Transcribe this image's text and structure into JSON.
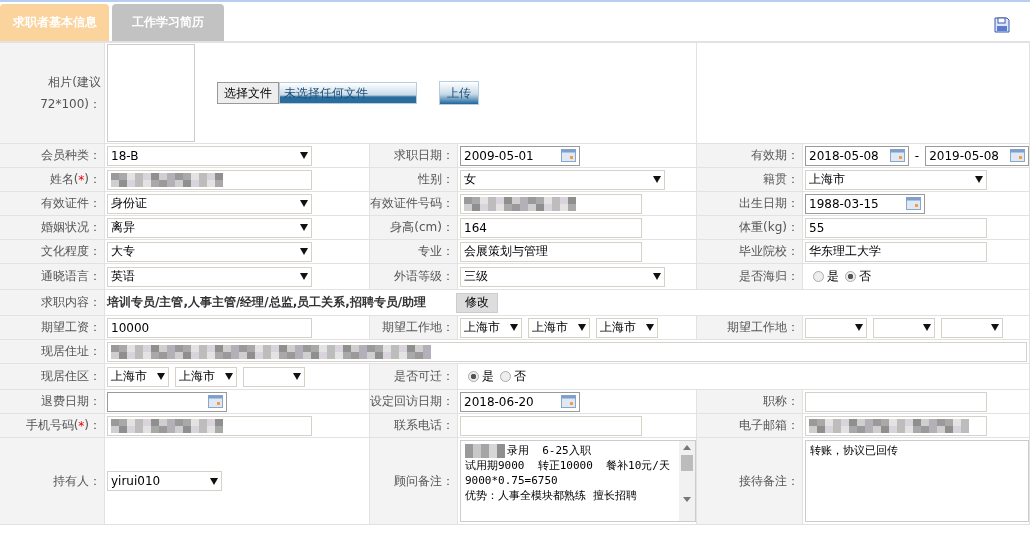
{
  "tabs": [
    {
      "label": "求职者基本信息",
      "selected": true
    },
    {
      "label": "工作学习简历",
      "selected": false
    }
  ],
  "photo": {
    "label": "相片(建议72*100)：",
    "choose_button": "选择文件",
    "file_status": "未选择任何文件",
    "upload_button": "上传"
  },
  "rows": [
    {
      "cells": [
        {
          "label": "会员种类：",
          "kind": "select",
          "value": "18-B"
        },
        {
          "label": "求职日期：",
          "kind": "date",
          "value": "2009-05-01"
        },
        {
          "label": "有效期：",
          "kind": "date-range",
          "from": "2018-05-08",
          "separator": "-",
          "to": "2019-05-08"
        }
      ]
    },
    {
      "cells": [
        {
          "label_parts": [
            {
              "text": "姓名(",
              "kind": "plain"
            },
            {
              "text": "*",
              "kind": "required"
            },
            {
              "text": ")：",
              "kind": "plain"
            }
          ],
          "kind": "redacted"
        },
        {
          "label": "性别：",
          "kind": "select",
          "value": "女"
        },
        {
          "label": "籍贯：",
          "kind": "select",
          "value": "上海市"
        }
      ]
    },
    {
      "cells": [
        {
          "label": "有效证件：",
          "kind": "select",
          "value": "身份证"
        },
        {
          "label": "有效证件号码：",
          "kind": "redacted"
        },
        {
          "label": "出生日期：",
          "kind": "date",
          "value": "1988-03-15"
        }
      ]
    },
    {
      "cells": [
        {
          "label": "婚姻状况：",
          "kind": "select",
          "value": "离异"
        },
        {
          "label": "身高(cm)：",
          "kind": "text",
          "value": "164"
        },
        {
          "label": "体重(kg)：",
          "kind": "text",
          "value": "55"
        }
      ]
    },
    {
      "cells": [
        {
          "label": "文化程度：",
          "kind": "select",
          "value": "大专"
        },
        {
          "label": "专业：",
          "kind": "text",
          "value": "会展策划与管理"
        },
        {
          "label": "毕业院校：",
          "kind": "text",
          "value": "华东理工大学"
        }
      ]
    },
    {
      "cells": [
        {
          "label": "通晓语言：",
          "kind": "select",
          "value": "英语"
        },
        {
          "label": "外语等级：",
          "kind": "select",
          "value": "三级"
        },
        {
          "label": "是否海归：",
          "kind": "radio",
          "options": [
            {
              "label": "是",
              "selected": false
            },
            {
              "label": "否",
              "selected": true
            }
          ]
        }
      ]
    },
    {
      "cells": [
        {
          "label": "求职内容：",
          "kind": "summary",
          "value": "培训专员/主管,人事主管/经理/总监,员工关系,招聘专员/助理",
          "button": "修改"
        }
      ]
    },
    {
      "cells": [
        {
          "label": "期望工资：",
          "kind": "text",
          "value": "10000"
        },
        {
          "label": "期望工作地：",
          "kind": "selects",
          "selects": [
            {
              "kind": "filled",
              "value": "上海市"
            },
            {
              "kind": "filled",
              "value": "上海市"
            },
            {
              "kind": "filled",
              "value": "上海市"
            }
          ]
        },
        {
          "label": "期望工作地：",
          "kind": "selects",
          "selects": [
            {
              "kind": "blank"
            },
            {
              "kind": "blank"
            },
            {
              "kind": "blank"
            }
          ]
        }
      ]
    },
    {
      "cells": [
        {
          "label": "现居住址：",
          "kind": "redacted"
        }
      ]
    },
    {
      "cells": [
        {
          "label": "现居住区：",
          "kind": "selects",
          "selects": [
            {
              "kind": "filled",
              "value": "上海市"
            },
            {
              "kind": "filled",
              "value": "上海市"
            },
            {
              "kind": "blank"
            }
          ]
        },
        {
          "label": "是否可迁：",
          "kind": "radio",
          "options": [
            {
              "label": "是",
              "selected": true
            },
            {
              "label": "否",
              "selected": false
            }
          ]
        }
      ]
    },
    {
      "cells": [
        {
          "label": "退费日期：",
          "kind": "date"
        },
        {
          "label": "设定回访日期：",
          "kind": "date",
          "value": "2018-06-20"
        },
        {
          "label": "职称：",
          "kind": "text"
        }
      ]
    },
    {
      "cells": [
        {
          "label_parts": [
            {
              "text": "手机号码(",
              "kind": "plain"
            },
            {
              "text": "*",
              "kind": "required"
            },
            {
              "text": ")：",
              "kind": "plain"
            }
          ],
          "kind": "redacted"
        },
        {
          "label": "联系电话：",
          "kind": "text"
        },
        {
          "label": "电子邮箱：",
          "kind": "redacted"
        }
      ]
    },
    {
      "cells": [
        {
          "label": "持有人：",
          "kind": "select",
          "value": "yirui010"
        },
        {
          "label": "顾问备注：",
          "kind": "textarea",
          "scroll": true,
          "lines": [
            {
              "text": "录用  6-25入职",
              "redacted": true
            },
            {
              "text": "试用期9000  转正10000  餐补10元/天",
              "redacted": false
            },
            {
              "text": "9000*0.75=6750",
              "redacted": false
            },
            {
              "text": "优势：人事全模块都熟练 擅长招聘",
              "redacted": false
            }
          ]
        },
        {
          "label": "接待备注：",
          "kind": "textarea",
          "scroll": false,
          "lines": [
            {
              "text": "转账，协议已回传",
              "redacted": false
            }
          ]
        }
      ]
    }
  ]
}
